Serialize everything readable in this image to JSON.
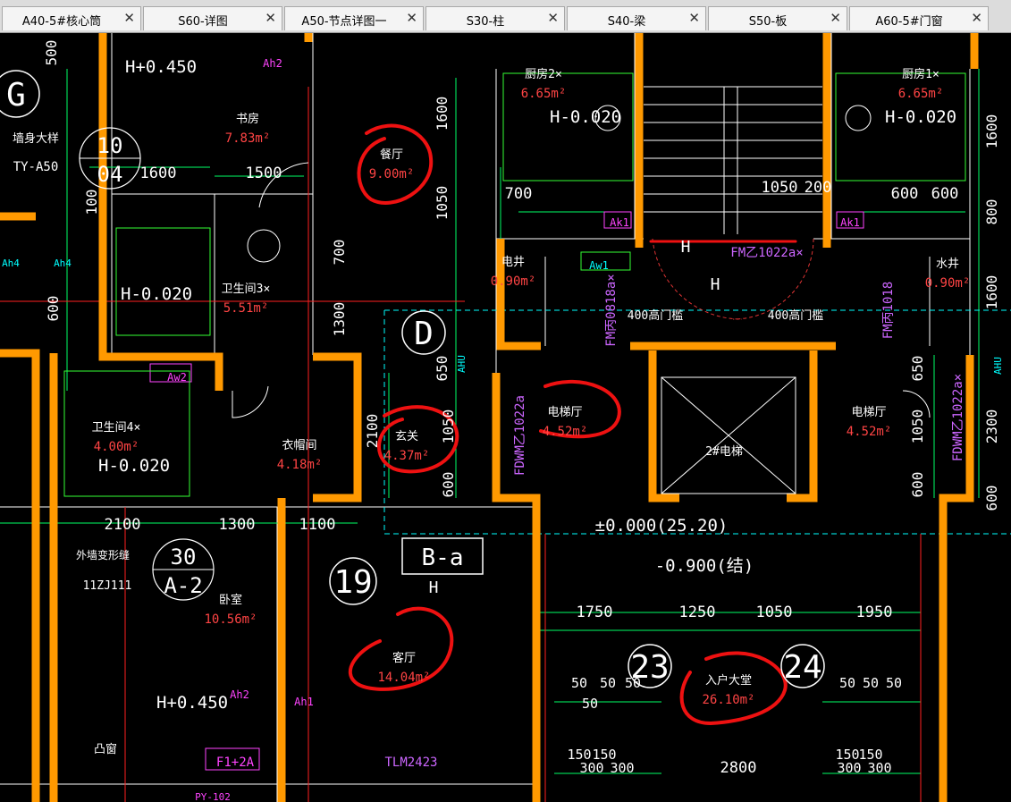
{
  "tabs": [
    {
      "label": "A40-5#核心筒"
    },
    {
      "label": "S60-详图"
    },
    {
      "label": "A50-节点详图一"
    },
    {
      "label": "S30-柱"
    },
    {
      "label": "S40-梁"
    },
    {
      "label": "S50-板"
    },
    {
      "label": "A60-5#门窗"
    }
  ],
  "tab_close_glyph": "✕",
  "colors": {
    "background": "#000000",
    "wall": "#ff9900",
    "dimension": "#00ff66",
    "text_white": "#ffffff",
    "area_red": "#ff4444",
    "annotation_red": "#ee1111",
    "cyan": "#00ffff",
    "magenta": "#ff44ff",
    "grid_red": "#ff2020"
  },
  "drawing": {
    "rooms": [
      {
        "name": "书房",
        "area": "7.83m²"
      },
      {
        "name": "餐厅",
        "area": "9.00m²"
      },
      {
        "name": "卫生间3×",
        "area": "5.51m²"
      },
      {
        "name": "卫生间4×",
        "area": "4.00m²"
      },
      {
        "name": "衣帽间",
        "area": "4.18m²"
      },
      {
        "name": "玄关",
        "area": "4.37m²"
      },
      {
        "name": "卧室",
        "area": "10.56m²"
      },
      {
        "name": "客厅",
        "area": "14.04m²"
      },
      {
        "name": "厨房2×",
        "area": "6.65m²"
      },
      {
        "name": "厨房1×",
        "area": "6.65m²"
      },
      {
        "name": "电井",
        "area": "0.90m²"
      },
      {
        "name": "水井",
        "area": "0.90m²"
      },
      {
        "name": "电梯厅",
        "area": "4.52m²"
      },
      {
        "name": "电梯厅",
        "area": "4.52m²"
      },
      {
        "name": "入户大堂",
        "area": "26.10m²"
      }
    ],
    "elevations": [
      "H+0.450",
      "H-0.020",
      "H-0.020",
      "H-0.020",
      "H-0.020",
      "H+0.450",
      "±0.000(25.20)",
      "-0.900(结)"
    ],
    "grid_labels": [
      "G",
      "D",
      "19",
      "23",
      "24",
      "B-a"
    ],
    "detail_refs": [
      {
        "top": "10",
        "bottom": "04"
      },
      {
        "top": "30",
        "bottom": "A-2"
      }
    ],
    "dimensions_horizontal": [
      "1600",
      "1500",
      "2100",
      "1300",
      "1100",
      "700",
      "1050",
      "200",
      "600",
      "600",
      "1750",
      "1250",
      "1050",
      "1950",
      "2800",
      "50",
      "50",
      "50",
      "50",
      "50",
      "50",
      "50",
      "150",
      "150",
      "150",
      "150",
      "300",
      "300",
      "300",
      "300"
    ],
    "dimensions_vertical": [
      "1600",
      "1050",
      "700",
      "1300",
      "600",
      "650",
      "1050",
      "600",
      "2100",
      "1600",
      "800",
      "1600",
      "650",
      "1050",
      "600",
      "2300",
      "100",
      "500",
      "600"
    ],
    "door_labels": [
      "FM乙1022a×",
      "FM丙0818a×",
      "FM丙1018",
      "FDWM乙1022a",
      "FDWM乙1022a×",
      "TLM2423"
    ],
    "misc_labels": [
      "墙身大样",
      "TY-A50",
      "外墙变形缝",
      "11ZJ111",
      "凸窗",
      "400高门槛",
      "400高门槛",
      "2#电梯",
      "H",
      "H",
      "H",
      "Ah1",
      "Ah2",
      "Ah2",
      "Ah4",
      "Ah4",
      "Ak1",
      "Ak1",
      "Aw1",
      "Aw2",
      "AHU",
      "AHU",
      "F1+2A",
      "PY-102"
    ]
  }
}
